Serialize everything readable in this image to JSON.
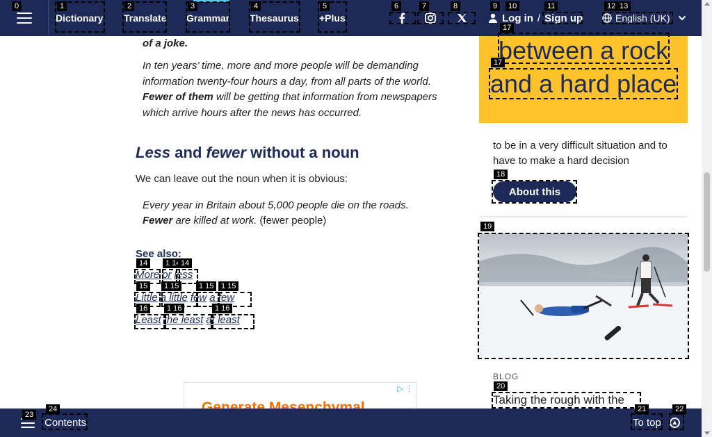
{
  "nav": {
    "links": [
      "Dictionary",
      "Translate",
      "Grammar",
      "Thesaurus",
      "+Plus"
    ],
    "login": "Log in",
    "login_sep": "/",
    "signup": "Sign up",
    "language": "English (UK)",
    "active_color": "#5ac8e6",
    "bar_color": "#1d2a57"
  },
  "article": {
    "example0": "of a joke.",
    "example1": "In ten years’ time, more and more people will be demanding information twenty-four hours a day, from all parts of the world.",
    "example2_bold": "Fewer of them",
    "example2_rest": " will be getting that information from newspapers which arrive hours after the news has occurred.",
    "heading_less": "Less",
    "heading_and": " and ",
    "heading_fewer": "fewer",
    "heading_rest": " without a noun",
    "paragraph": "We can leave out the noun when it is obvious:",
    "example3": "Every year in Britain about 5,000 people die on the roads.",
    "example4_bold": "Fewer",
    "example4_rest": " are killed at work.",
    "example4_note": " (fewer people)",
    "see_also": "See also:",
    "see_also_rows": [
      [
        "More",
        "or",
        "less"
      ],
      [
        "Little",
        "a little",
        "few",
        "a few"
      ],
      [
        "Least",
        "the least",
        "at least"
      ]
    ],
    "ad_text": "Generate Mesenchymal"
  },
  "sidebar": {
    "wotd_line1": "between a rock",
    "wotd_line2": "and a hard place",
    "wotd_definition": "to be in a very difficult situation and to have to make a hard decision",
    "about_button": "About this",
    "blog_label": "BLOG",
    "blog_title": "Taking the rough with the",
    "accent_color": "#fec22d"
  },
  "bottom": {
    "contents": "Contents",
    "to_top": "To top"
  },
  "markers": {
    "m0": "0",
    "m1": "1",
    "m2": "2",
    "m3": "3",
    "m4": "4",
    "m5": "5",
    "m6": "6",
    "m7": "7",
    "m8": "8",
    "m9": "9",
    "m10": "10",
    "m11": "11",
    "m12": "12",
    "m13": "13",
    "m14": "14",
    "m15": "15",
    "m16": "16",
    "m17": "17",
    "m18": "18",
    "m19": "19",
    "m20": "20",
    "m21": "21",
    "m22": "22",
    "m23": "23",
    "m24": "24",
    "m14b": "1 14",
    "m14c": "14",
    "m15b": "1 15",
    "m15c": "1 15",
    "m15d": "1 15",
    "m16b": "1 16",
    "m16c": "1 16"
  },
  "icons": {
    "menu": "hamburger-icon",
    "facebook": "facebook-icon",
    "instagram": "instagram-icon",
    "x": "x-twitter-icon",
    "user": "user-icon",
    "globe": "globe-icon",
    "chevron": "chevron-down-icon",
    "up": "arrow-up-circle-icon"
  }
}
